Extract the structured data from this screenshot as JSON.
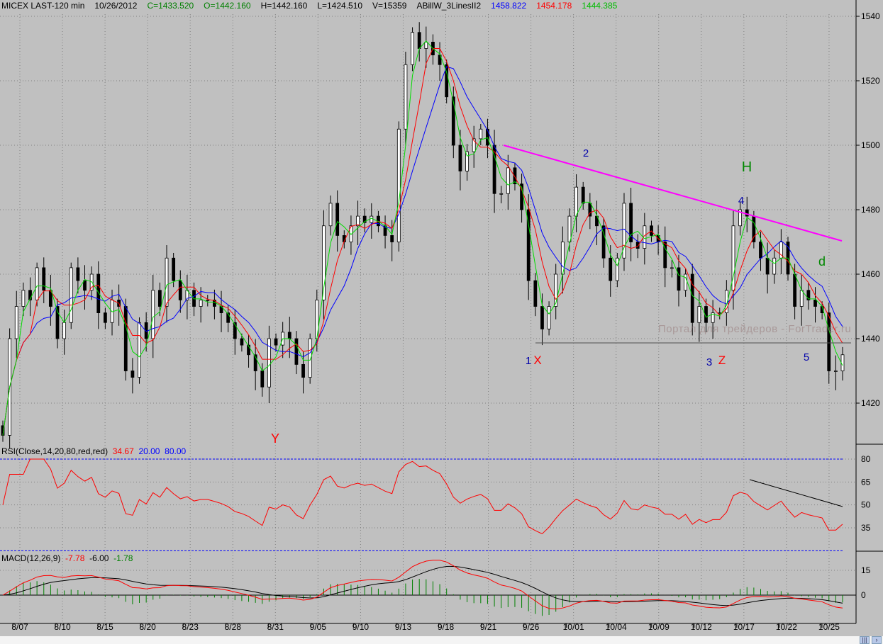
{
  "header": {
    "symbol": "MICEX LAST-120 min",
    "date": "10/26/2012",
    "close": "C=1433.520",
    "open": "O=1442.160",
    "high": "H=1442.160",
    "low": "L=1424.510",
    "volume": "V=15359",
    "indicator": "ABillW_3LinesII2",
    "line1": "1458.822",
    "line2": "1454.178",
    "line3": "1444.385"
  },
  "rsi_header": {
    "label": "RSI(Close,14,20,80,red,red)",
    "value": "34.67",
    "low": "20.00",
    "high": "80.00"
  },
  "macd_header": {
    "label": "MACD(12,26,9)",
    "macd": "-7.78",
    "signal": "-6.00",
    "hist": "-1.78"
  },
  "watermark": "Портал для трейдеров - ForTrader.ru",
  "annotations": [
    "Y",
    "1",
    "X",
    "2",
    "3",
    "Z",
    "4",
    "H",
    "5",
    "d"
  ],
  "colors": {
    "bg": "#c0c0c0",
    "ma_fast": "#00dd00",
    "ma_mid": "#ff0000",
    "ma_slow": "#0000ff",
    "trendline": "#ff00ff",
    "rsi": "#ff0000",
    "macd": "#ff0000",
    "signal": "#000000",
    "hist": "#008000"
  },
  "chart_data": [
    {
      "type": "candlestick",
      "title": "MICEX LAST-120 min",
      "ylim": [
        1405,
        1545
      ],
      "yticks": [
        1420,
        1440,
        1460,
        1480,
        1500,
        1520,
        1540
      ],
      "xticks": [
        "8/07",
        "8/10",
        "8/15",
        "8/20",
        "8/23",
        "8/28",
        "8/31",
        "9/05",
        "9/10",
        "9/13",
        "9/18",
        "9/21",
        "9/26",
        "10/01",
        "10/04",
        "10/09",
        "10/12",
        "10/17",
        "10/22",
        "10/25"
      ],
      "close": [
        1410,
        1440,
        1450,
        1455,
        1452,
        1462,
        1455,
        1450,
        1440,
        1445,
        1462,
        1458,
        1455,
        1460,
        1448,
        1445,
        1452,
        1450,
        1430,
        1428,
        1445,
        1440,
        1455,
        1450,
        1465,
        1458,
        1452,
        1455,
        1450,
        1452,
        1452,
        1450,
        1448,
        1445,
        1440,
        1438,
        1435,
        1430,
        1425,
        1440,
        1438,
        1442,
        1440,
        1432,
        1428,
        1440,
        1452,
        1475,
        1482,
        1472,
        1470,
        1475,
        1478,
        1476,
        1478,
        1475,
        1472,
        1470,
        1505,
        1525,
        1535,
        1530,
        1532,
        1528,
        1525,
        1515,
        1500,
        1492,
        1498,
        1502,
        1505,
        1500,
        1485,
        1485,
        1493,
        1488,
        1480,
        1458,
        1450,
        1443,
        1450,
        1460,
        1470,
        1478,
        1487,
        1482,
        1478,
        1475,
        1465,
        1458,
        1465,
        1482,
        1470,
        1468,
        1475,
        1472,
        1470,
        1462,
        1462,
        1455,
        1460,
        1445,
        1450,
        1445,
        1448,
        1448,
        1455,
        1475,
        1480,
        1478,
        1470,
        1465,
        1460,
        1465,
        1470,
        1460,
        1450,
        1455,
        1452,
        1450,
        1448,
        1430,
        1430,
        1435
      ]
    },
    {
      "type": "line",
      "name": "RSI",
      "ylim": [
        15,
        85
      ],
      "yticks": [
        35,
        50,
        65,
        80
      ],
      "levels": [
        20,
        80
      ]
    },
    {
      "type": "bar+line",
      "name": "MACD",
      "params": [
        12,
        26,
        9
      ],
      "yticks": [
        0,
        15
      ]
    }
  ]
}
